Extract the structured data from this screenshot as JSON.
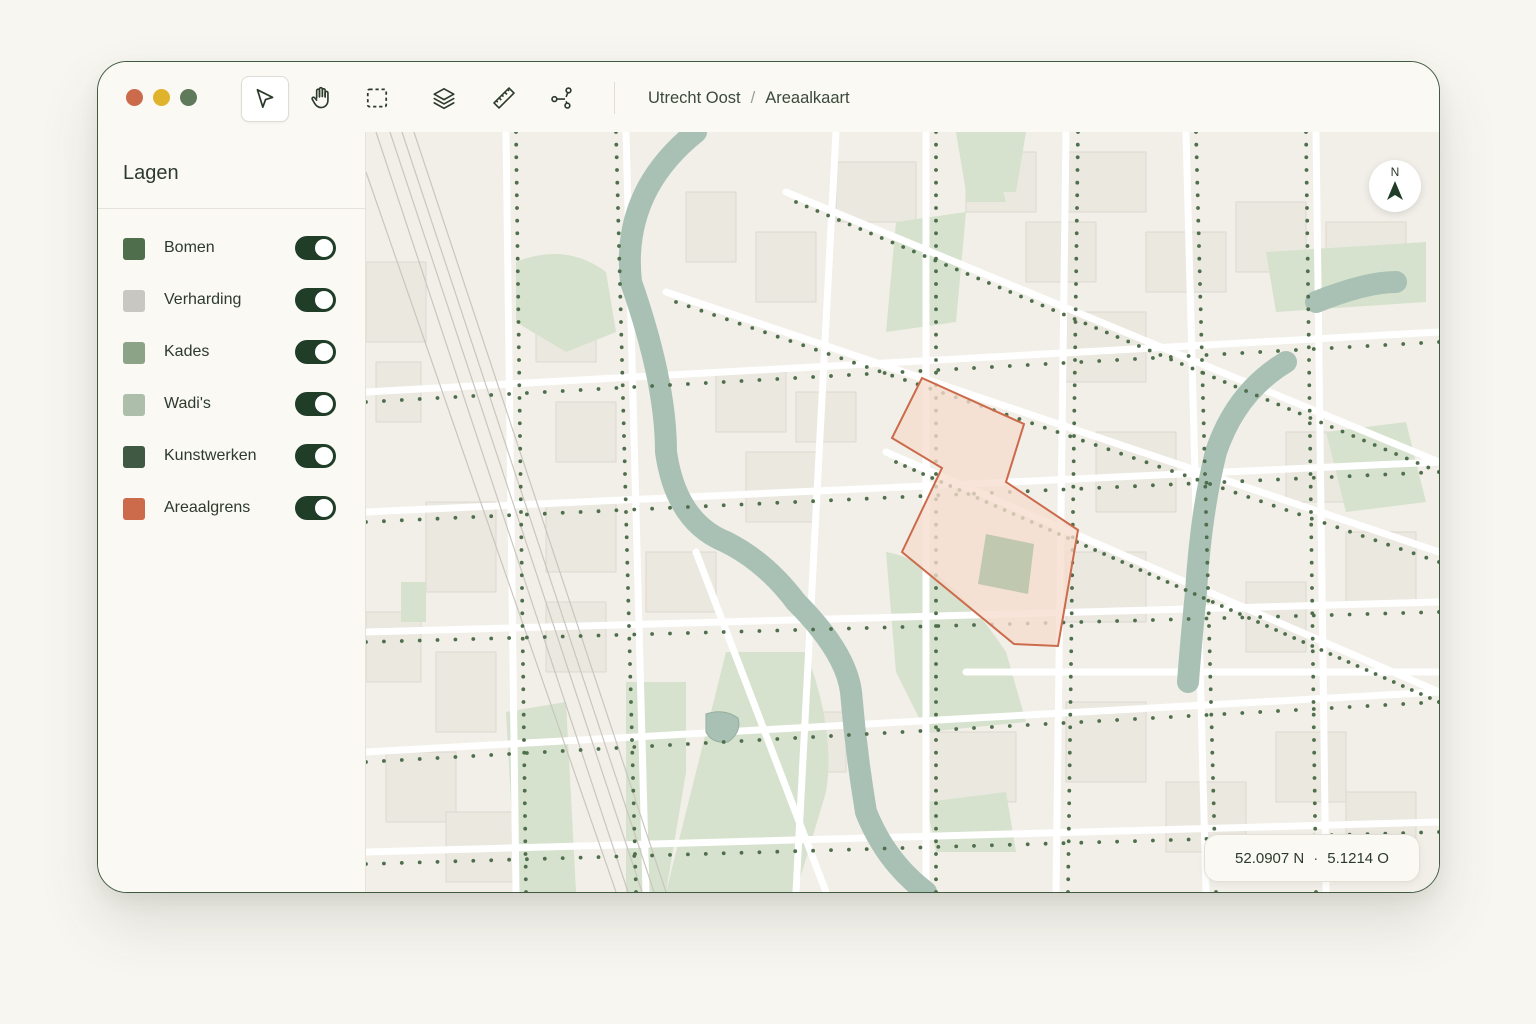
{
  "window": {
    "traffic_lights": [
      "#cc6a4c",
      "#e0b32c",
      "#5f7a5b"
    ]
  },
  "toolbar": {
    "tools": [
      {
        "name": "select",
        "icon": "cursor-arrow-icon",
        "active": true
      },
      {
        "name": "pan",
        "icon": "hand-icon",
        "active": false
      },
      {
        "name": "area-select",
        "icon": "dashed-rectangle-icon",
        "active": false
      },
      {
        "name": "layers",
        "icon": "layers-icon",
        "active": false
      },
      {
        "name": "measure",
        "icon": "ruler-icon",
        "active": false
      },
      {
        "name": "path",
        "icon": "node-path-icon",
        "active": false
      }
    ]
  },
  "breadcrumb": {
    "items": [
      "Utrecht Oost",
      "Areaalkaart"
    ],
    "separator": "/"
  },
  "sidebar": {
    "title": "Lagen",
    "layers": [
      {
        "label": "Bomen",
        "color": "#4f6f4c",
        "on": true
      },
      {
        "label": "Verharding",
        "color": "#c8c7c1",
        "on": true
      },
      {
        "label": "Kades",
        "color": "#8da387",
        "on": true
      },
      {
        "label": "Wadi's",
        "color": "#adbfaa",
        "on": true
      },
      {
        "label": "Kunstwerken",
        "color": "#3f5943",
        "on": true
      },
      {
        "label": "Areaalgrens",
        "color": "#cc6a4c",
        "on": true
      }
    ]
  },
  "map": {
    "compass_label": "N",
    "coordinates": {
      "lat": "52.0907 N",
      "separator": "·",
      "lon": "5.1214 O"
    },
    "colors": {
      "water": "#a9c1b4",
      "green": "#d6e2cd",
      "tree": "#4e6e4c",
      "boundary_stroke": "#cc6a4c",
      "boundary_fill": "#f6dccd",
      "road": "#ffffff"
    }
  }
}
